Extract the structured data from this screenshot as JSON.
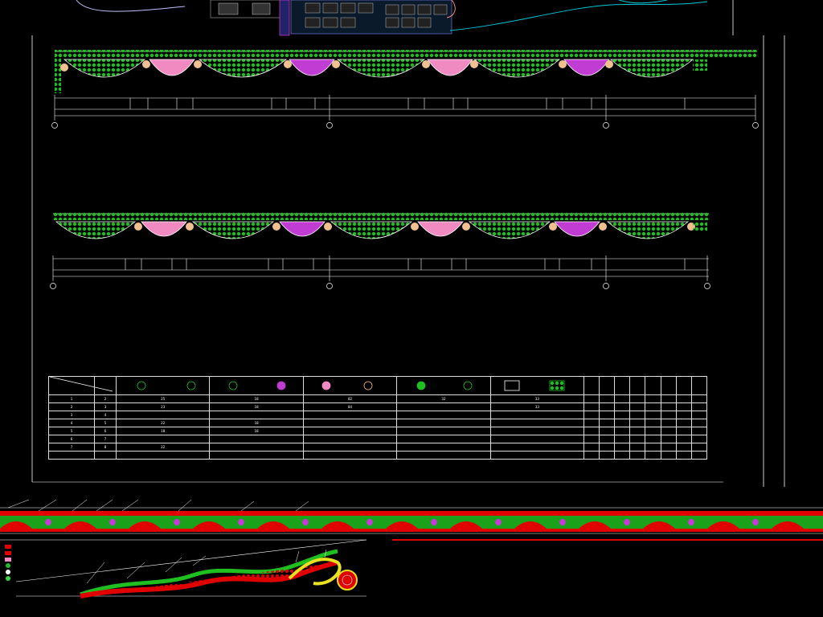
{
  "drawing": {
    "background": "#000000",
    "colors": {
      "line": "#ffffff",
      "green": "#1fbf1f",
      "light_green": "#3ad83a",
      "pink": "#f08ac0",
      "magenta": "#c03cd2",
      "red": "#e00000",
      "peach": "#f0c090",
      "yellow": "#e8e020",
      "cyan": "#00c8d8"
    }
  },
  "table": {
    "header": [
      "",
      "",
      "",
      "",
      "",
      "",
      "",
      "",
      "",
      "",
      "",
      "",
      "",
      "",
      ""
    ],
    "rows": [
      [
        "1",
        "2",
        "25",
        "18",
        "82",
        "32",
        "33",
        "",
        "",
        "",
        "",
        "",
        "",
        "",
        ""
      ],
      [
        "2",
        "3",
        "23",
        "18",
        "84",
        "",
        "33",
        "",
        "",
        "",
        "",
        "",
        "",
        "",
        ""
      ],
      [
        "3",
        "4",
        "",
        "",
        "",
        "",
        "",
        "",
        "",
        "",
        "",
        "",
        "",
        "",
        ""
      ],
      [
        "4",
        "5",
        "22",
        "18",
        "",
        "",
        "",
        "",
        "",
        "",
        "",
        "",
        "",
        "",
        ""
      ],
      [
        "5",
        "6",
        "18",
        "18",
        "",
        "",
        "",
        "",
        "",
        "",
        "",
        "",
        "",
        "",
        ""
      ],
      [
        "6",
        "7",
        "",
        "",
        "",
        "",
        "",
        "",
        "",
        "",
        "",
        "",
        "",
        "",
        ""
      ],
      [
        "7",
        "8",
        "22",
        "",
        "",
        "",
        "",
        "",
        "",
        "",
        "",
        "",
        "",
        "",
        ""
      ],
      [
        "",
        "",
        "",
        "",
        "",
        "",
        "",
        "",
        "",
        "",
        "",
        "",
        "",
        "",
        ""
      ]
    ]
  }
}
